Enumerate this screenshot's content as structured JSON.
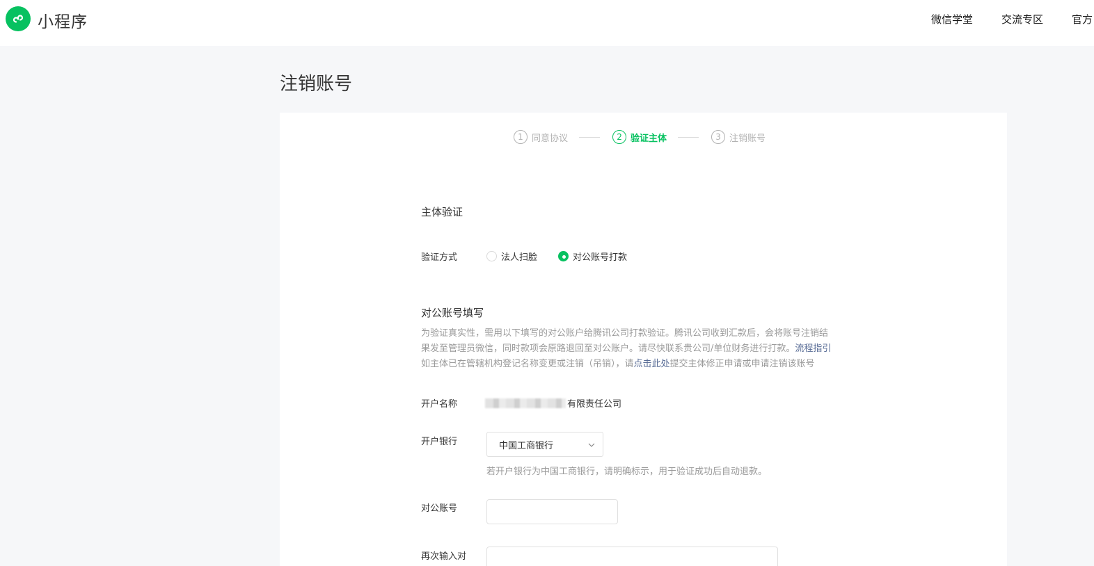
{
  "header": {
    "brand": "小程序",
    "nav": [
      "微信学堂",
      "交流专区",
      "官方"
    ]
  },
  "page": {
    "title": "注销账号"
  },
  "stepper": {
    "steps": [
      {
        "num": "1",
        "label": "同意协议"
      },
      {
        "num": "2",
        "label": "验证主体"
      },
      {
        "num": "3",
        "label": "注销账号"
      }
    ],
    "active_index": 1
  },
  "verify": {
    "section_title": "主体验证",
    "method_label": "验证方式",
    "options": [
      "法人扫脸",
      "对公账号打款"
    ],
    "selected": "对公账号打款"
  },
  "account": {
    "section_title": "对公账号填写",
    "desc_line1": "为验证真实性，需用以下填写的对公账户给腾讯公司打款验证。腾讯公司收到汇款后，会将账号注销结",
    "desc_line2": "果发至管理员微信，同时款项会原路退回至对公账户。请尽快联系贵公司/单位财务进行打款。",
    "desc_link1": "流程指引",
    "desc_line3_pre": "如主体已在管辖机构登记名称变更或注销（吊销），请",
    "desc_link2": "点击此处",
    "desc_line3_post": "提交主体修正申请或申请注销该账号",
    "name_label": "开户名称",
    "name_value_visible": "有限责任公司",
    "bank_label": "开户银行",
    "bank_value": "中国工商银行",
    "bank_hint": "若开户银行为中国工商银行，请明确标示，用于验证成功后自动退款。",
    "number_label": "对公账号",
    "number_value": "",
    "confirm_label": "再次输入对",
    "confirm_value": ""
  },
  "colors": {
    "accent": "#07c160",
    "link": "#576b95",
    "muted": "#9a9a9a"
  }
}
